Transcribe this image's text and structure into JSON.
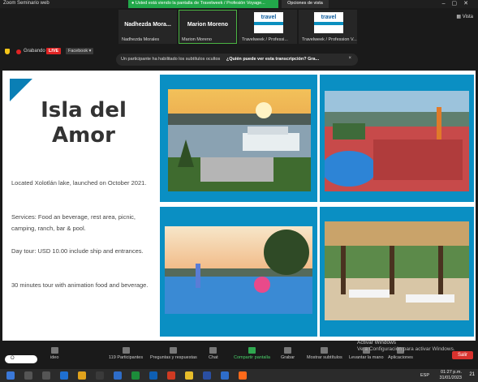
{
  "window": {
    "title": "Zoom Seminario web",
    "share_banner": "Usted está viendo la pantalla de Travelweek / Profesión Voyage...",
    "view_options": "Opciones de vista",
    "view_label": "Vista"
  },
  "participants": [
    {
      "big_name": "Nadhezda Mora...",
      "caption": "Nadhezda Morales",
      "active": false
    },
    {
      "big_name": "Marion Moreno",
      "caption": "Marion Moreno",
      "active": true
    },
    {
      "logo": "travelweek",
      "caption": "Travelweek / Professi..."
    },
    {
      "logo": "travelweek",
      "caption": "Travelweek / Profession V..."
    }
  ],
  "recording": {
    "label": "Grabando",
    "live_badge": "LIVE",
    "destination": "Facebook"
  },
  "subtitle_notice": {
    "text": "Un participante ha habilitado los subtítulos ocultos",
    "question": "¿Quién puede ver esta transcripción? Gra...",
    "close": "×"
  },
  "slide": {
    "title_line1": "Isla del",
    "title_line2": "Amor",
    "paragraphs": [
      "Located Xolotlán lake, launched on October 2021.",
      "Services: Food an beverage, rest area, picnic, camping, ranch, bar & pool.",
      "Day tour: USD 10.00 include ship and entrances.",
      "30 minutes tour with animation food and beverage."
    ],
    "panel_color": "#0a8fc3"
  },
  "controls": {
    "participants_label": "Participantes",
    "participants_count": "119",
    "qa_label": "Preguntas y respuestas",
    "chat_label": "Chat",
    "share_label": "Compartir pantalla",
    "record_label": "Grabar",
    "subtitles_label": "Mostrar subtítulos",
    "raise_hand_label": "Levantar la mano",
    "apps_label": "Aplicaciones",
    "video_label": "ideo",
    "leave_label": "Salir"
  },
  "activation": {
    "line1": "Activar Windows",
    "line2": "Ve a Configuración para activar Windows."
  },
  "windows_taskbar": {
    "search_text": "O",
    "language": "ESP",
    "time": "01:27 p.m.",
    "date": "31/01/2023",
    "notification_count": "21"
  }
}
